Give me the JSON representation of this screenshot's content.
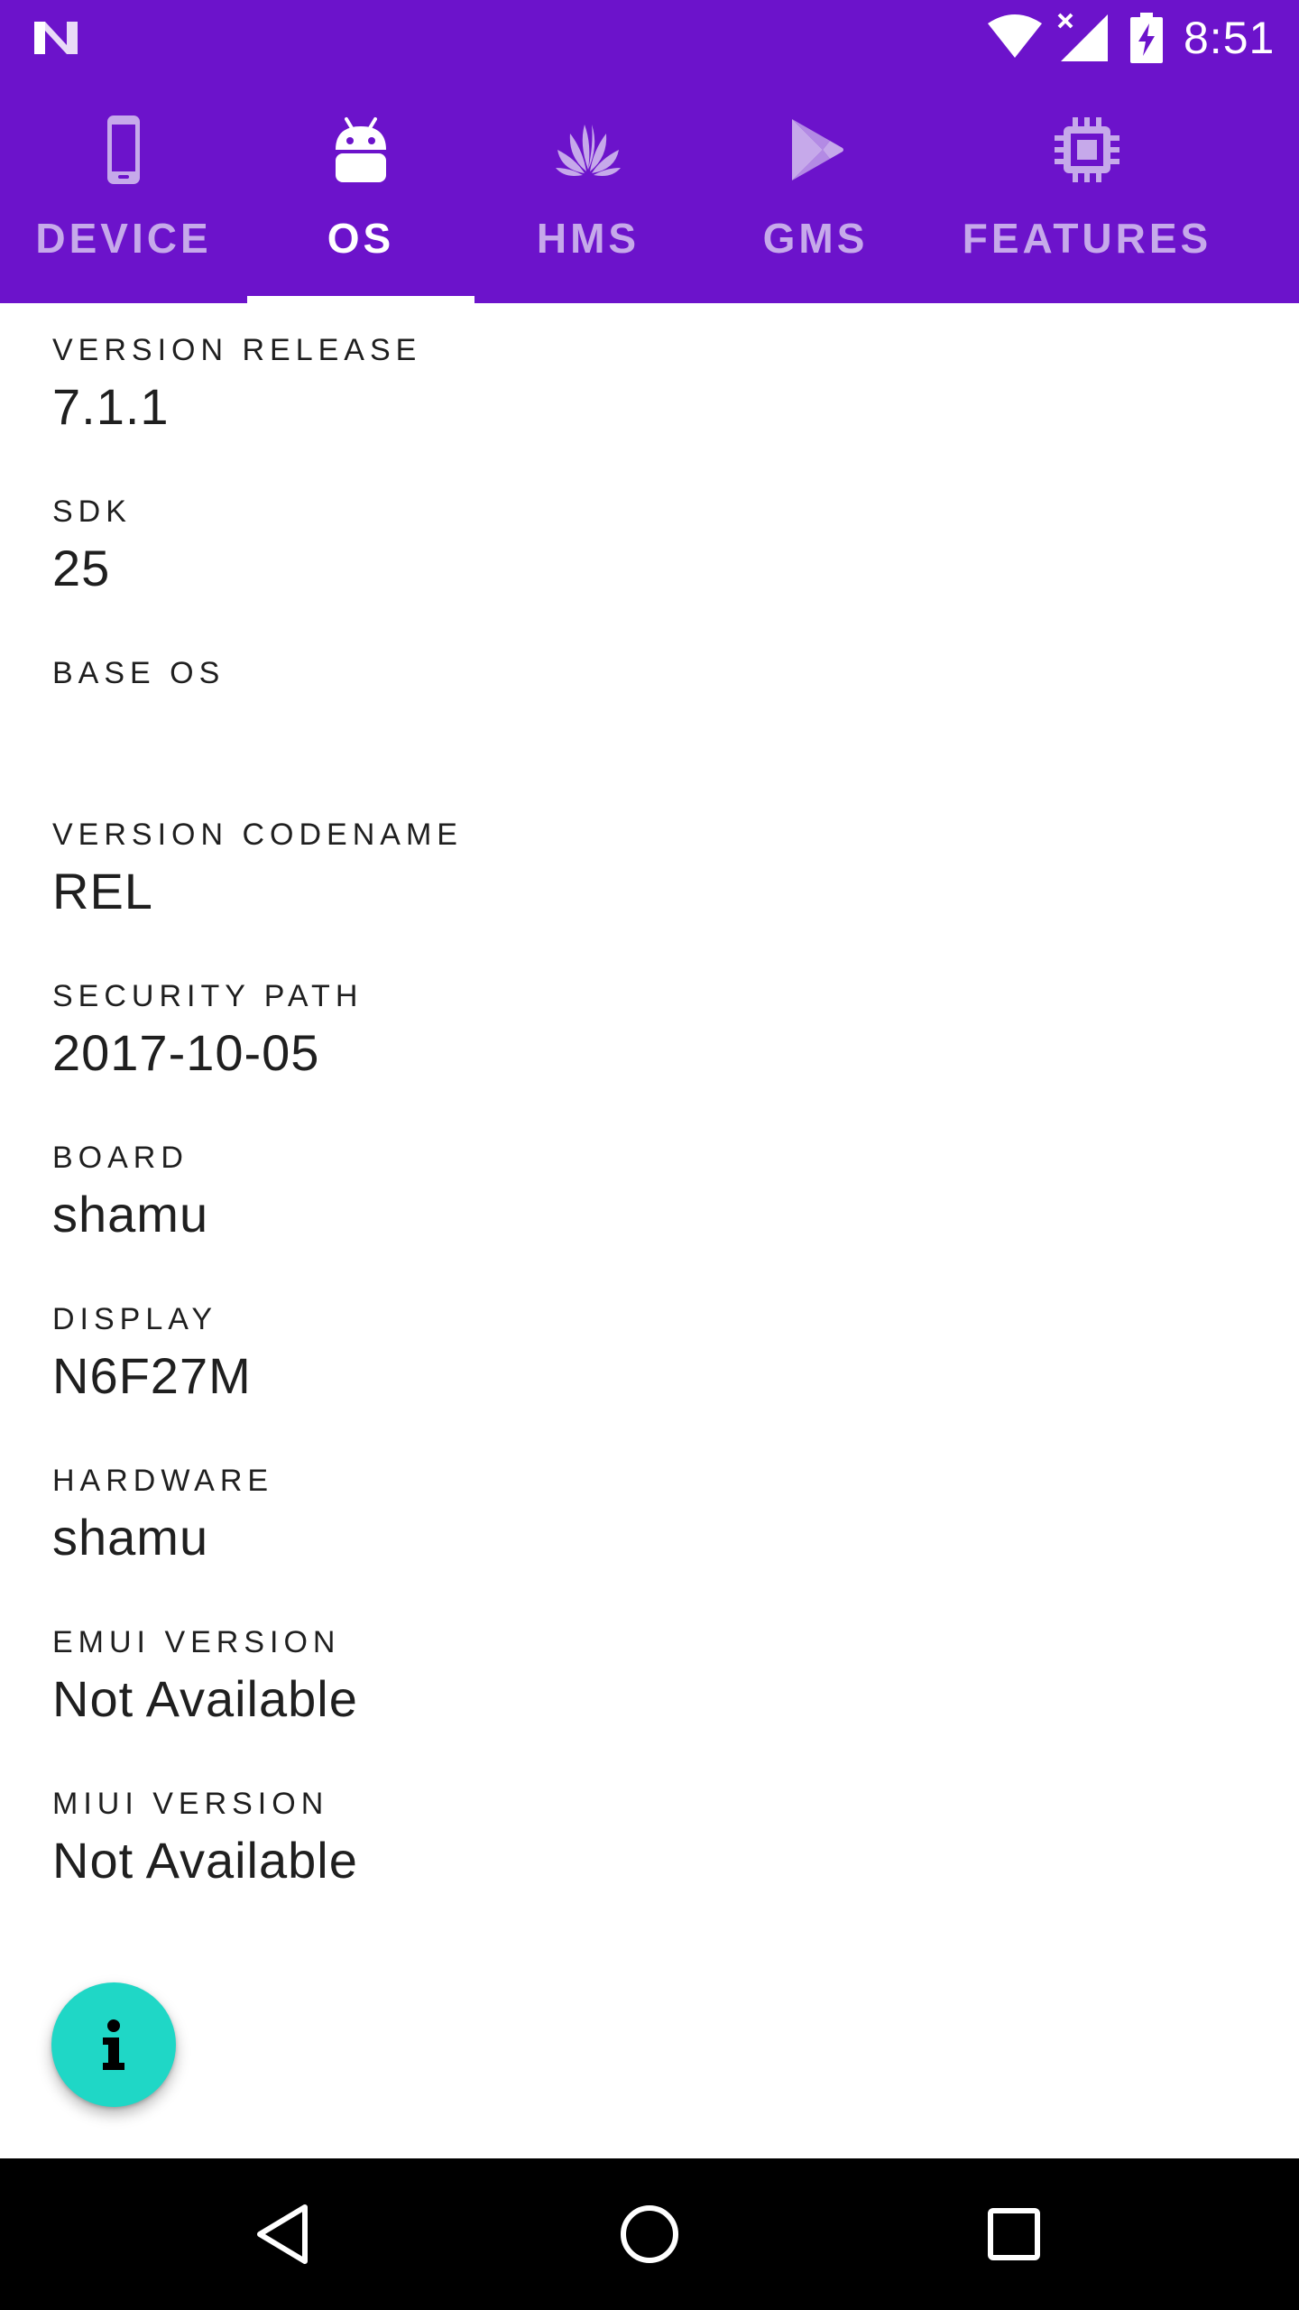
{
  "status_bar": {
    "time": "8:51",
    "background": "#6c13cb",
    "icons": [
      "n-logo",
      "wifi-icon",
      "signal-icon",
      "battery-charging-icon"
    ]
  },
  "tabs": [
    {
      "label": "DEVICE",
      "icon": "phone-icon",
      "active": false
    },
    {
      "label": "OS",
      "icon": "android-icon",
      "active": true
    },
    {
      "label": "HMS",
      "icon": "huawei-icon",
      "active": false
    },
    {
      "label": "GMS",
      "icon": "play-store-icon",
      "active": false
    },
    {
      "label": "FEATURES",
      "icon": "chip-icon",
      "active": false
    }
  ],
  "items": [
    {
      "label": "VERSION RELEASE",
      "value": "7.1.1"
    },
    {
      "label": "SDK",
      "value": "25"
    },
    {
      "label": "BASE OS",
      "value": ""
    },
    {
      "label": "VERSION CODENAME",
      "value": "REL"
    },
    {
      "label": "SECURITY PATH",
      "value": "2017-10-05"
    },
    {
      "label": "BOARD",
      "value": "shamu"
    },
    {
      "label": "DISPLAY",
      "value": "N6F27M"
    },
    {
      "label": "HARDWARE",
      "value": "shamu"
    },
    {
      "label": "EMUI VERSION",
      "value": "Not Available"
    },
    {
      "label": "MIUI VERSION",
      "value": "Not Available"
    }
  ],
  "fab": {
    "icon": "info-icon",
    "color": "#1fd7c6"
  },
  "nav_bar": {
    "buttons": [
      "back-icon",
      "home-icon",
      "recent-apps-icon"
    ]
  },
  "colors": {
    "primary": "#6c13cb",
    "tab_inactive": "#c6a9ea",
    "tab_active": "#ffffff",
    "accent": "#1fd7c6",
    "text": "#1f1f1f"
  }
}
